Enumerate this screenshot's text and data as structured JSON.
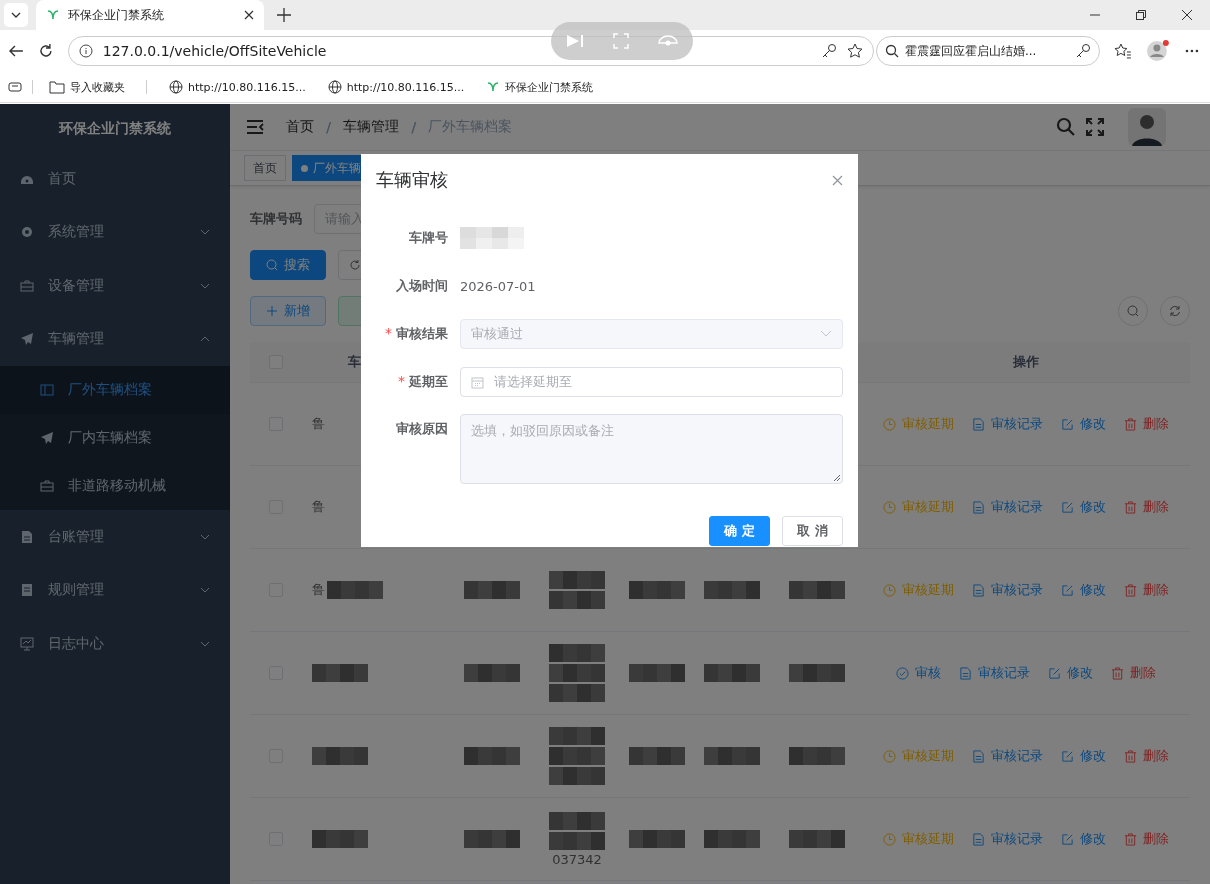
{
  "browser": {
    "tabs": [
      {
        "title": "环保企业门禁系统",
        "selected": true
      }
    ],
    "url": "127.0.0.1/vehicle/OffSiteVehicle",
    "search_text": "霍震霆回应霍启山结婚...",
    "bookmarks": [
      {
        "label": "导入收藏夹",
        "kind": "import"
      },
      {
        "label": "http://10.80.116.15...",
        "kind": "globe"
      },
      {
        "label": "http://10.80.116.15...",
        "kind": "globe"
      },
      {
        "label": "环保企业门禁系统",
        "kind": "leaf"
      }
    ]
  },
  "sidebar": {
    "title": "环保企业门禁系统",
    "items": [
      {
        "label": "首页",
        "selected": false
      },
      {
        "label": "系统管理",
        "selected": false,
        "expanded": false
      },
      {
        "label": "设备管理",
        "selected": false,
        "expanded": false
      },
      {
        "label": "车辆管理",
        "selected": false,
        "expanded": true,
        "children": [
          {
            "label": "厂外车辆档案",
            "selected": true
          },
          {
            "label": "厂内车辆档案",
            "selected": false
          },
          {
            "label": "非道路移动机械",
            "selected": false
          }
        ]
      },
      {
        "label": "台账管理",
        "selected": false,
        "expanded": false
      },
      {
        "label": "规则管理",
        "selected": false,
        "expanded": false
      },
      {
        "label": "日志中心",
        "selected": false,
        "expanded": false
      }
    ]
  },
  "breadcrumb": {
    "separator": "/",
    "items": [
      "首页",
      "车辆管理",
      "厂外车辆档案"
    ]
  },
  "tags": [
    {
      "label": "首页",
      "selected": false
    },
    {
      "label": "厂外车辆",
      "selected": true
    }
  ],
  "search_form": {
    "label": "车牌号码",
    "placeholder": "请输入",
    "search_button": "搜索",
    "add_button": "新增"
  },
  "table": {
    "columns": [
      "车",
      "操作"
    ],
    "all_checked": false,
    "rows": [
      {
        "checked": false,
        "cells": [
          [
            {
              "kind": "text",
              "text": "鲁"
            }
          ]
        ],
        "actions": [
          {
            "kind": "delay",
            "label": "审核延期"
          },
          {
            "kind": "record",
            "label": "审核记录"
          },
          {
            "kind": "edit",
            "label": "修改"
          },
          {
            "kind": "delete",
            "label": "删除"
          }
        ]
      },
      {
        "checked": false,
        "cells": [
          [
            {
              "kind": "text",
              "text": "鲁"
            }
          ]
        ],
        "actions": [
          {
            "kind": "delay",
            "label": "审核延期"
          },
          {
            "kind": "record",
            "label": "审核记录"
          },
          {
            "kind": "edit",
            "label": "修改"
          },
          {
            "kind": "delete",
            "label": "删除"
          }
        ]
      },
      {
        "checked": false,
        "cells": [
          [
            {
              "kind": "text",
              "text": "鲁"
            },
            {
              "kind": "redacted"
            }
          ],
          [
            {
              "kind": "redacted"
            }
          ],
          [
            {
              "kind": "redacted"
            },
            {
              "kind": "redacted"
            }
          ],
          [
            {
              "kind": "redacted"
            }
          ],
          [
            {
              "kind": "redacted"
            }
          ],
          [
            {
              "kind": "redacted"
            }
          ]
        ],
        "actions": [
          {
            "kind": "delay",
            "label": "审核延期"
          },
          {
            "kind": "record",
            "label": "审核记录"
          },
          {
            "kind": "edit",
            "label": "修改"
          },
          {
            "kind": "delete",
            "label": "删除"
          }
        ]
      },
      {
        "checked": false,
        "cells": [
          [
            {
              "kind": "redacted"
            }
          ],
          [
            {
              "kind": "redacted"
            }
          ],
          [
            {
              "kind": "redacted"
            },
            {
              "kind": "redacted"
            },
            {
              "kind": "redacted"
            }
          ],
          [
            {
              "kind": "redacted"
            }
          ],
          [
            {
              "kind": "redacted"
            }
          ],
          [
            {
              "kind": "redacted"
            }
          ]
        ],
        "actions": [
          {
            "kind": "audit",
            "label": "审核"
          },
          {
            "kind": "record",
            "label": "审核记录"
          },
          {
            "kind": "edit",
            "label": "修改"
          },
          {
            "kind": "delete",
            "label": "删除"
          }
        ]
      },
      {
        "checked": false,
        "cells": [
          [
            {
              "kind": "redacted"
            }
          ],
          [
            {
              "kind": "redacted"
            }
          ],
          [
            {
              "kind": "redacted"
            },
            {
              "kind": "redacted"
            },
            {
              "kind": "redacted"
            }
          ],
          [
            {
              "kind": "redacted"
            }
          ],
          [
            {
              "kind": "redacted"
            }
          ],
          [
            {
              "kind": "redacted"
            }
          ]
        ],
        "actions": [
          {
            "kind": "delay",
            "label": "审核延期"
          },
          {
            "kind": "record",
            "label": "审核记录"
          },
          {
            "kind": "edit",
            "label": "修改"
          },
          {
            "kind": "delete",
            "label": "删除"
          }
        ]
      },
      {
        "checked": false,
        "cells": [
          [
            {
              "kind": "redacted"
            }
          ],
          [
            {
              "kind": "redacted"
            }
          ],
          [
            {
              "kind": "redacted"
            },
            {
              "kind": "redacted"
            },
            {
              "kind": "text",
              "text": "037342"
            }
          ],
          [
            {
              "kind": "redacted"
            }
          ],
          [
            {
              "kind": "redacted"
            }
          ],
          [
            {
              "kind": "redacted"
            }
          ]
        ],
        "actions": [
          {
            "kind": "delay",
            "label": "审核延期"
          },
          {
            "kind": "record",
            "label": "审核记录"
          },
          {
            "kind": "edit",
            "label": "修改"
          },
          {
            "kind": "delete",
            "label": "删除"
          }
        ]
      }
    ]
  },
  "dialog": {
    "title": "车辆审核",
    "required_mark": "*",
    "fields": [
      {
        "label": "车牌号",
        "kind": "redacted",
        "required": false
      },
      {
        "label": "入场时间",
        "kind": "text",
        "value": "2026-07-01",
        "required": false
      },
      {
        "label": "审核结果",
        "kind": "select",
        "value": "审核通过",
        "required": true,
        "disabled": true
      },
      {
        "label": "延期至",
        "kind": "date",
        "placeholder": "请选择延期至",
        "required": true
      },
      {
        "label": "审核原因",
        "kind": "textarea",
        "placeholder": "选填，如驳回原因或备注",
        "required": false
      }
    ],
    "buttons": [
      {
        "label": "确 定",
        "kind": "primary"
      },
      {
        "label": "取 消",
        "kind": "default"
      }
    ]
  }
}
